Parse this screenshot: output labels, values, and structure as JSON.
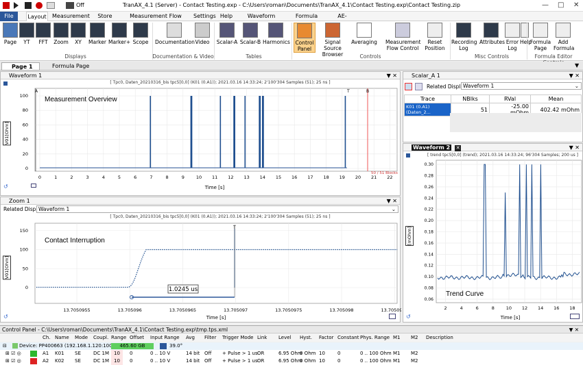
{
  "app": {
    "title": "TranAX_4.1 (Server) - Contact Testing.exp - C:\\Users\\roman\\Documents\\TranAX_4.1\\Contact Testing.exp\\Contact Testing.zip",
    "off_label": "Off"
  },
  "menu": {
    "tabs": [
      "File",
      "Layout",
      "Measurement",
      "Store Data",
      "Measurement Flow Control",
      "Settings",
      "Help",
      "Waveform Display",
      "Formula Editor",
      "AE-Plugin"
    ]
  },
  "ribbon": {
    "buttons": [
      "Page",
      "YT",
      "FFT",
      "Zoom",
      "XY",
      "Marker",
      "Marker+",
      "Scope",
      "Documentation",
      "Video",
      "Scalar-A",
      "Scalar-B",
      "Harmonics",
      "Control Panel",
      "Signal Source Browser",
      "Averaging",
      "Measurement Flow Control",
      "Reset Position",
      "Recording Log",
      "Attributes",
      "Error Log",
      "Help",
      "Formula Page",
      "Add Formula"
    ],
    "groups": [
      "Displays",
      "Documentation & Video",
      "Tables",
      "Controls",
      "Misc Controls",
      "Formula Editor Controls"
    ]
  },
  "doc_tabs": [
    "Page 1",
    "Formula Page 1"
  ],
  "waveform1": {
    "title": "Waveform 1",
    "info": "[ Tpc0, Daten_20210316_bis tpc5[0,0] (K01 (0.A1)); 2021.03.16 14:33:24; 2'100'304 Samples (51); 25 ns ]",
    "overlay": "Measurement Overview",
    "ylabel": "V01[Ohm]",
    "xlabel": "Time [s]",
    "blocks": "50 / 51 Blocks",
    "xticks": [
      "0",
      "1",
      "2",
      "3",
      "4",
      "5",
      "6",
      "7",
      "8",
      "9",
      "10",
      "11",
      "12",
      "13",
      "14",
      "15",
      "16",
      "17",
      "18",
      "19",
      "20",
      "21",
      "22"
    ],
    "yticks": [
      "100",
      "80",
      "60",
      "40",
      "20",
      "0"
    ],
    "marker_a": "A",
    "marker_b": "B",
    "marker_t": "T",
    "spikes_s": [
      6.95,
      9.5,
      9.55,
      11.35,
      12.2,
      12.25,
      12.9,
      13.8,
      13.85,
      14.0,
      14.05,
      19.2
    ]
  },
  "zoom1": {
    "title": "Zoom 1",
    "related_label": "Related Display:",
    "related_value": "Waveform 1",
    "info": "[ Tpc0, Daten_20210316_bis tpc5[0,0] (K01 (0.A1)); 2021.03.16 14:33:24; 2'100'304 Samples (51); 25 ns ]",
    "overlay": "Contact Interruption",
    "ylabel": "V01[Ohm]",
    "xlabel": "Time [s]",
    "measure": "1.0245 us",
    "xticks": [
      "13.7050955",
      "13.705096",
      "13.7050965",
      "13.705097",
      "13.7050975",
      "13.705098",
      "13.7050985"
    ],
    "yticks": [
      "150",
      "100",
      "50",
      "0"
    ],
    "marker_t": "T"
  },
  "scalar": {
    "title": "Scalar_A 1",
    "related_label": "Related Display:",
    "related_value": "Waveform 1",
    "headers": [
      "Trace",
      "NBlks",
      "RVal",
      "Mean"
    ],
    "row": [
      "K01 (0.A1) (Daten_2...",
      "51",
      "-25.00 mOhm",
      "402.42 mOhm"
    ]
  },
  "waveform2": {
    "title": "Waveform 2",
    "info": "[ trend tpc5[0,0] (trend); 2021.03.16 14:33:24; 96'304 Samples; 200 us ]",
    "overlay": "Trend Curve",
    "ylabel": "[mOhm]",
    "xlabel": "Time [s]",
    "xticks": [
      "2",
      "4",
      "6",
      "8",
      "10",
      "12",
      "14",
      "16",
      "18"
    ],
    "yticks": [
      "0.30",
      "0.28",
      "0.26",
      "0.24",
      "0.22",
      "0.20",
      "0.18",
      "0.16",
      "0.14",
      "0.12",
      "0.10",
      "0.08",
      "0.06"
    ]
  },
  "control_panel": {
    "title": "Control Panel - C:\\Users\\roman\\Documents\\TranAX_4.1\\Contact Testing.exp\\tmp.tps.xml",
    "columns": [
      "Ch.",
      "Name",
      "Mode",
      "Coupl.",
      "Range",
      "Offset",
      "Input Range",
      "Avg",
      "Filter",
      "Trigger Mode",
      "Link",
      "Level",
      "Hyst.",
      "Factor",
      "Constant",
      "Phys. Range",
      "M1",
      "M2",
      "Description"
    ],
    "device": {
      "label": "Device: PP400663 (192.168.1.120:10010)",
      "storage": "465.60 GB",
      "temp": "39.0°"
    },
    "rows": [
      [
        "A1",
        "K01",
        "SE",
        "DC 1M",
        "10",
        "0",
        "0 .. 10 V",
        "14 bit",
        "Off",
        "+ Pulse > 1 us",
        "OR",
        "6.95 Ohm",
        "0 Ohm",
        "10",
        "0",
        "0 .. 100 Ohm",
        "M1",
        "M2",
        ""
      ],
      [
        "A2",
        "K02",
        "SE",
        "DC 1M",
        "10",
        "0",
        "0 .. 10 V",
        "14 bit",
        "Off",
        "+ Pulse > 1 us",
        "OR",
        "6.95 Ohm",
        "0 Ohm",
        "10",
        "0",
        "0 .. 100 Ohm",
        "M1",
        "M2",
        ""
      ]
    ]
  }
}
